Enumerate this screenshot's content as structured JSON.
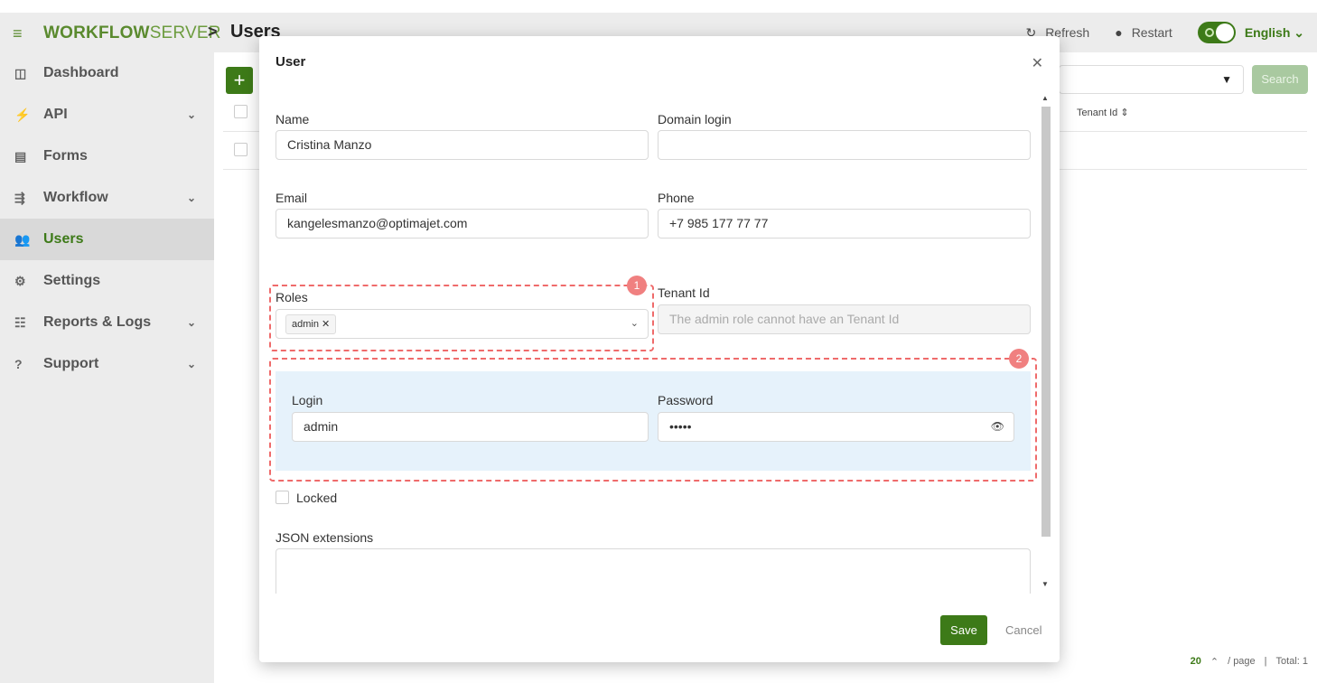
{
  "header": {
    "logo_bold": "WORKFLOW",
    "logo_light": "SERVER",
    "breadcrumb_sep": ">",
    "page_title": "Users",
    "refresh_label": "Refresh",
    "restart_label": "Restart",
    "language": "English"
  },
  "sidebar": {
    "items": [
      {
        "label": "Dashboard",
        "icon": "dashboard-icon"
      },
      {
        "label": "API",
        "icon": "plug-icon"
      },
      {
        "label": "Forms",
        "icon": "form-icon"
      },
      {
        "label": "Workflow",
        "icon": "workflow-icon"
      },
      {
        "label": "Users",
        "icon": "users-icon"
      },
      {
        "label": "Settings",
        "icon": "gear-icon"
      },
      {
        "label": "Reports & Logs",
        "icon": "report-icon"
      },
      {
        "label": "Support",
        "icon": "help-icon"
      }
    ]
  },
  "background": {
    "search_label": "Search",
    "column_tenant": "Tenant Id",
    "page_size": "20",
    "per_page_label": "/ page",
    "total_label": "Total: 1"
  },
  "modal": {
    "title": "User",
    "name_label": "Name",
    "name_value": "Cristina Manzo",
    "domain_login_label": "Domain login",
    "domain_login_value": "",
    "email_label": "Email",
    "email_value": "kangelesmanzo@optimajet.com",
    "phone_label": "Phone",
    "phone_value": "+7 985 177 77 77",
    "roles_label": "Roles",
    "roles_tag": "admin",
    "tenant_label": "Tenant Id",
    "tenant_placeholder": "The admin role cannot have an Tenant Id",
    "login_label": "Login",
    "login_value": "admin",
    "password_label": "Password",
    "password_value": "•••••",
    "locked_label": "Locked",
    "json_label": "JSON extensions",
    "save_label": "Save",
    "cancel_label": "Cancel",
    "badge_1": "1",
    "badge_2": "2"
  }
}
